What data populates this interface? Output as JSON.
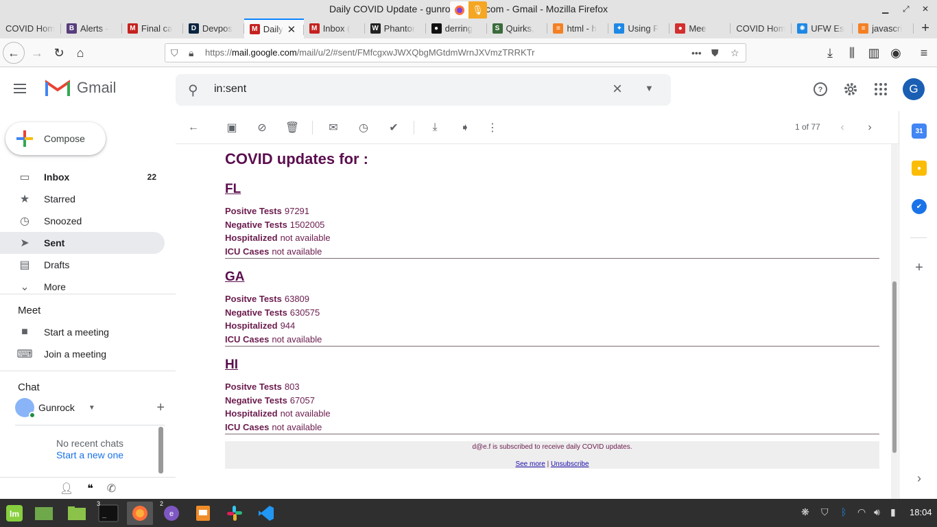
{
  "window": {
    "title": "Daily COVID Update - gunrock2...ail.com - Gmail - Mozilla Firefox"
  },
  "tabs": [
    {
      "label": "COVID Hom",
      "icon": "none",
      "color": "#e3e3e3"
    },
    {
      "label": "Alerts -",
      "icon": "B",
      "color": "#563d7c"
    },
    {
      "label": "Final ca",
      "icon": "M",
      "color": "#c5221f"
    },
    {
      "label": "Devpos",
      "icon": "D",
      "color": "#0a2540"
    },
    {
      "label": "Daily",
      "icon": "M",
      "color": "#c5221f",
      "active": true
    },
    {
      "label": "Inbox (",
      "icon": "M",
      "color": "#c5221f"
    },
    {
      "label": "Phantor",
      "icon": "W",
      "color": "#222222"
    },
    {
      "label": "derring",
      "icon": "●",
      "color": "#111111"
    },
    {
      "label": "Quirks,",
      "icon": "S",
      "color": "#3b6b3b"
    },
    {
      "label": "html - h",
      "icon": "≡",
      "color": "#f48024"
    },
    {
      "label": "Using F",
      "icon": "✦",
      "color": "#1e88e5"
    },
    {
      "label": "Mee",
      "icon": "●",
      "color": "#d32f2f"
    },
    {
      "label": "COVID Hom",
      "icon": "none",
      "color": "#e3e3e3"
    },
    {
      "label": "UFW Es",
      "icon": "✺",
      "color": "#1e88e5"
    },
    {
      "label": "javascri",
      "icon": "≡",
      "color": "#f48024"
    }
  ],
  "url": {
    "prefix": "https://",
    "host": "mail.google.com",
    "path": "/mail/u/2/#sent/FMfcgxwJWXQbgMGtdmWrnJXVmzTRRKTr"
  },
  "gmail": {
    "brand": "Gmail",
    "search_query": "in:sent",
    "avatar_letter": "G",
    "compose": "Compose",
    "nav": [
      {
        "label": "Inbox",
        "count": "22",
        "icon": "inbox-icon",
        "glyph": "▭"
      },
      {
        "label": "Starred",
        "count": "",
        "icon": "star-icon",
        "glyph": "★"
      },
      {
        "label": "Snoozed",
        "count": "",
        "icon": "clock-icon",
        "glyph": "◷"
      },
      {
        "label": "Sent",
        "count": "",
        "icon": "send-icon",
        "glyph": "➤"
      },
      {
        "label": "Drafts",
        "count": "",
        "icon": "draft-icon",
        "glyph": "▤"
      },
      {
        "label": "More",
        "count": "",
        "icon": "chevron-down-icon",
        "glyph": "⌄"
      }
    ],
    "meet": {
      "title": "Meet",
      "items": [
        "Start a meeting",
        "Join a meeting"
      ]
    },
    "chat": {
      "title": "Chat",
      "user": "Gunrock",
      "empty": "No recent chats",
      "start": "Start a new one"
    },
    "pager": "1 of 77"
  },
  "email": {
    "heading": "COVID updates for :",
    "states": [
      {
        "name": "FL",
        "rows": [
          {
            "k": "Positve Tests",
            "v": "97291"
          },
          {
            "k": "Negative Tests",
            "v": "1502005"
          },
          {
            "k": "Hospitalized",
            "v": "not available"
          },
          {
            "k": "ICU Cases",
            "v": "not available"
          }
        ]
      },
      {
        "name": "GA",
        "rows": [
          {
            "k": "Positve Tests",
            "v": "63809"
          },
          {
            "k": "Negative Tests",
            "v": "630575"
          },
          {
            "k": "Hospitalized",
            "v": "944"
          },
          {
            "k": "ICU Cases",
            "v": "not available"
          }
        ]
      },
      {
        "name": "HI",
        "rows": [
          {
            "k": "Positve Tests",
            "v": "803"
          },
          {
            "k": "Negative Tests",
            "v": "67057"
          },
          {
            "k": "Hospitalized",
            "v": "not available"
          },
          {
            "k": "ICU Cases",
            "v": "not available"
          }
        ]
      }
    ],
    "footer_text": "d@e.f is subscribed to receive daily COVID updates.",
    "see_more": "See more",
    "sep": " | ",
    "unsubscribe": "Unsubscribe"
  },
  "taskbar": {
    "clock": "18:04",
    "terminal_badge": "3",
    "emacs_badge": "2"
  }
}
